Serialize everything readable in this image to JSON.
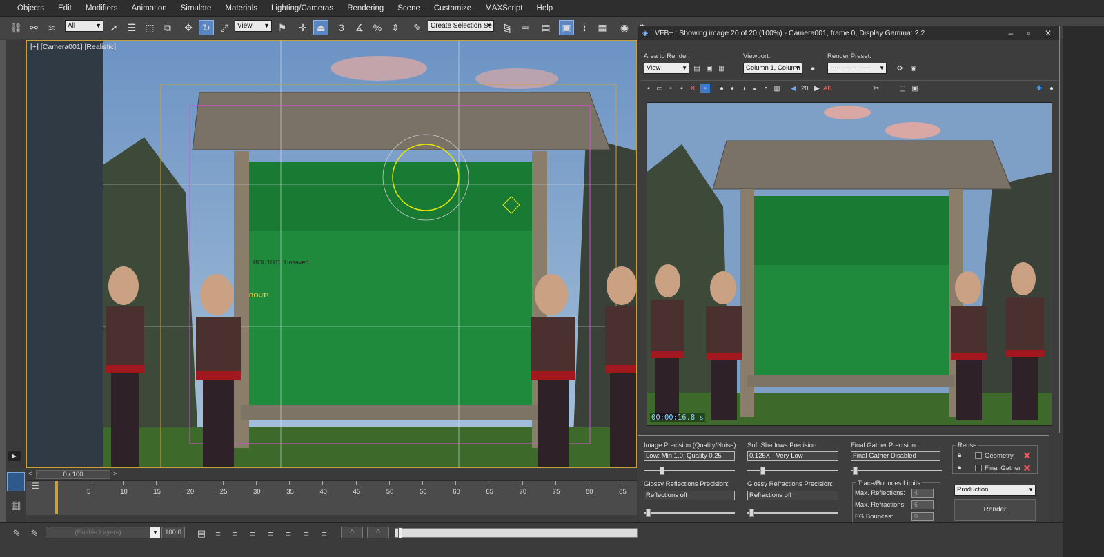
{
  "menu": [
    "Objects",
    "Edit",
    "Modifiers",
    "Animation",
    "Simulate",
    "Materials",
    "Lighting/Cameras",
    "Rendering",
    "Scene",
    "Customize",
    "MAXScript",
    "Help"
  ],
  "toolbar": {
    "filter_value": "All",
    "ref_coord_value": "View",
    "selection_set_value": "Create Selection Se",
    "snap_labels": [
      "3",
      "%"
    ]
  },
  "viewport": {
    "label": "[+] [Camera001] [Realistic]",
    "object_label": "BOUT001: Unsaved",
    "sign_text": "BOUT!"
  },
  "vfb": {
    "title": "VFB+ : Showing image 20 of 20 (100%) - Camera001, frame 0, Display Gamma: 2.2",
    "area_label": "Area to Render:",
    "area_value": "View",
    "viewport_label": "Viewport:",
    "viewport_value": "Column 1, Column",
    "preset_label": "Render Preset:",
    "preset_value": "-------------------",
    "image_index": "20",
    "timestamp": "00:00:16.8 s",
    "ab_label": "AB"
  },
  "render_panel": {
    "image_precision_label": "Image Precision (Quality/Noise):",
    "image_precision_value": "Low: Min 1.0, Quality 0.25",
    "image_precision_level": 0.18,
    "soft_shadows_label": "Soft Shadows Precision:",
    "soft_shadows_value": "0.125X - Very Low",
    "soft_shadows_level": 0.15,
    "final_gather_label": "Final Gather Precision:",
    "final_gather_value": "Final Gather Disabled",
    "final_gather_level": 0.02,
    "glossy_refl_label": "Glossy Reflections Precision:",
    "glossy_refl_value": "Reflections off",
    "glossy_refl_level": 0.02,
    "glossy_refr_label": "Glossy Refractions Precision:",
    "glossy_refr_value": "Refractions off",
    "glossy_refr_level": 0.02,
    "trace_label": "Trace/Bounces Limits",
    "max_refl_label": "Max. Reflections:",
    "max_refl_value": "4",
    "max_refr_label": "Max. Refractions:",
    "max_refr_value": "6",
    "fg_bounces_label": "FG Bounces:",
    "fg_bounces_value": "0",
    "reuse_label": "Reuse",
    "geometry_label": "Geometry",
    "final_gather_reuse_label": "Final Gather",
    "preset_value": "Production",
    "render_label": "Render"
  },
  "timeline": {
    "frame_display": "0 / 100",
    "ticks": [
      "5",
      "10",
      "15",
      "20",
      "25",
      "30",
      "35",
      "40",
      "45",
      "50",
      "55",
      "60",
      "65",
      "70",
      "75",
      "80",
      "85"
    ]
  },
  "bottom": {
    "layers_placeholder": "(Enable Layers)",
    "percent_value": "100.0",
    "spin_a": "0",
    "spin_b": "0"
  },
  "colors": {
    "selection_yellow": "#c9a13b",
    "active_blue": "#5a86c4",
    "chalkboard_green": "#1f8a3c",
    "timestamp_cyan": "#7fd4ff",
    "close_red": "#ff5a5a"
  }
}
